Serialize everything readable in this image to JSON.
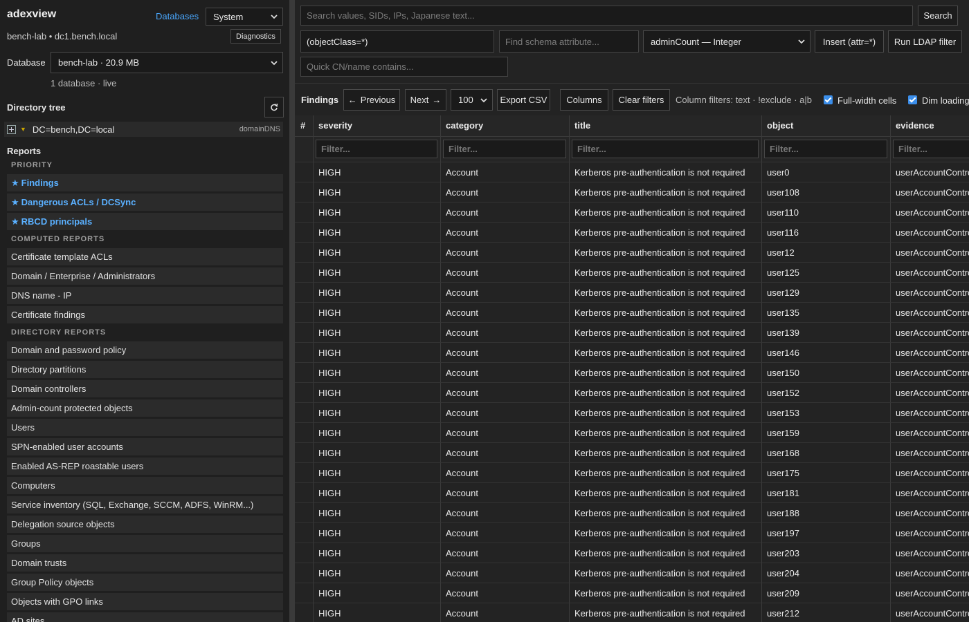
{
  "sidebar": {
    "app_name": "adexview",
    "databases_link": "Databases",
    "theme_select": "System",
    "host": "bench-lab • dc1.bench.local",
    "diagnostics_button": "Diagnostics",
    "database_label": "Database",
    "database_select": "bench-lab · 20.9 MB",
    "database_count": "1 database · live",
    "directory_tree_heading": "Directory tree",
    "tree": {
      "label": "DC=bench,DC=local",
      "type": "domainDNS"
    },
    "reports_heading": "Reports",
    "sections": [
      {
        "title": "PRIORITY",
        "items": [
          "Findings",
          "Dangerous ACLs / DCSync",
          "RBCD principals"
        ]
      },
      {
        "title": "COMPUTED REPORTS",
        "items": [
          "Certificate template ACLs",
          "Domain / Enterprise / Administrators",
          "DNS name - IP",
          "Certificate findings"
        ]
      },
      {
        "title": "DIRECTORY REPORTS",
        "items": [
          "Domain and password policy",
          "Directory partitions",
          "Domain controllers",
          "Admin-count protected objects",
          "Users",
          "SPN-enabled user accounts",
          "Enabled AS-REP roastable users",
          "Computers",
          "Service inventory (SQL, Exchange, SCCM, ADFS, WinRM...)",
          "Delegation source objects",
          "Groups",
          "Domain trusts",
          "Group Policy objects",
          "Objects with GPO links",
          "AD sites"
        ]
      }
    ]
  },
  "search": {
    "placeholder": "Search values, SIDs, IPs, Japanese text...",
    "button": "Search",
    "ldap_filter_value": "(objectClass=*)",
    "schema_placeholder": "Find schema attribute...",
    "attribute_select": "adminCount — Integer",
    "insert_button": "Insert (attr=*)",
    "run_button": "Run LDAP filter",
    "quick_placeholder": "Quick CN/name contains..."
  },
  "toolbar": {
    "title": "Findings",
    "previous": "Previous",
    "next": "Next",
    "page_size": "100",
    "export": "Export CSV",
    "columns": "Columns",
    "clear_filters": "Clear filters",
    "column_filters_hint": "Column filters: text · !exclude · a|b",
    "full_width_label": "Full-width cells",
    "dim_loading_label": "Dim loading"
  },
  "table": {
    "headers": [
      "#",
      "severity",
      "category",
      "title",
      "object",
      "evidence"
    ],
    "filter_placeholder": "Filter...",
    "severity": "HIGH",
    "category": "Account",
    "title": "Kerberos pre-authentication is not required",
    "evidence": "userAccountControl",
    "objects": [
      "user0",
      "user108",
      "user110",
      "user116",
      "user12",
      "user125",
      "user129",
      "user135",
      "user139",
      "user146",
      "user150",
      "user152",
      "user153",
      "user159",
      "user168",
      "user175",
      "user181",
      "user188",
      "user197",
      "user203",
      "user204",
      "user209",
      "user212"
    ]
  }
}
